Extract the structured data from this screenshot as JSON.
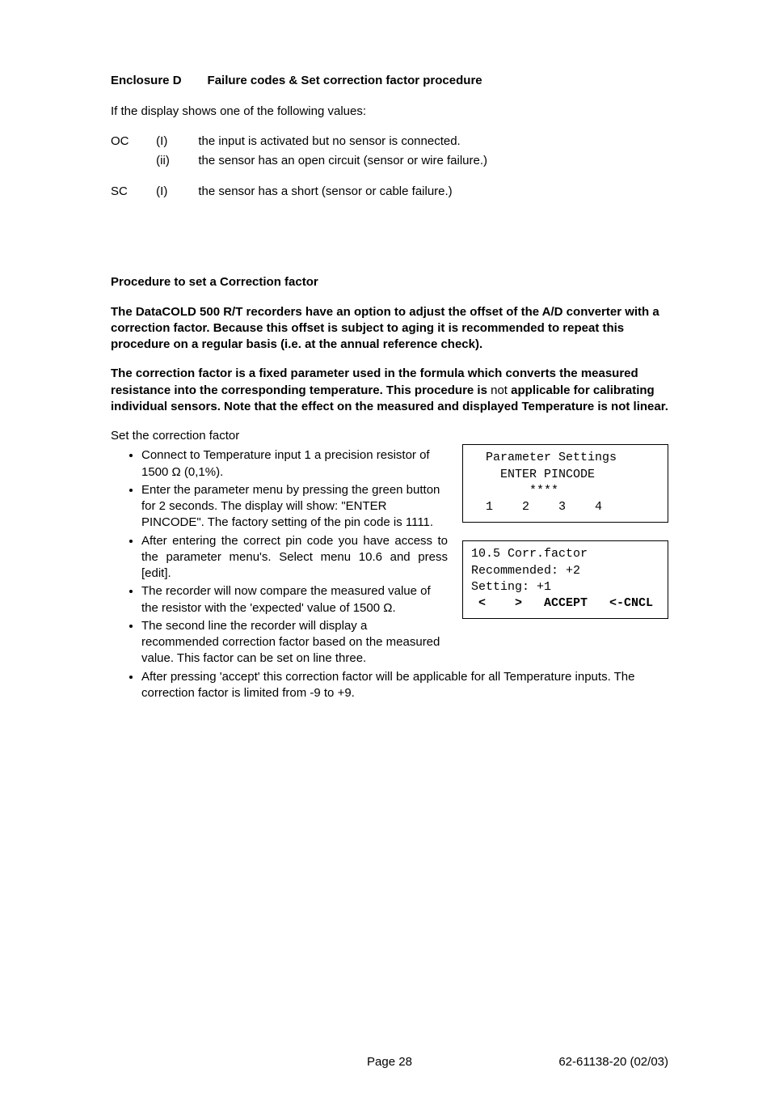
{
  "heading": {
    "label": "Enclosure D",
    "title": "Failure codes  &  Set correction factor procedure"
  },
  "intro": "If the display shows one of the following values:",
  "codes": {
    "oc": {
      "label": "OC",
      "rows": [
        {
          "roman": "(I)",
          "text": "the input is activated but no sensor is connected."
        },
        {
          "roman": "(ii)",
          "text": "the sensor has an open circuit (sensor or wire failure.)"
        }
      ]
    },
    "sc": {
      "label": "SC",
      "rows": [
        {
          "roman": "(I)",
          "text": "the sensor has a short (sensor or cable failure.)"
        }
      ]
    }
  },
  "procTitle": "Procedure to set a Correction factor",
  "para1": "The DataCOLD 500 R/T recorders have an option to adjust the offset of the A/D converter with a correction factor. Because this offset is subject to aging it is recommended to repeat this procedure on a regular basis (i.e. at the annual reference check).",
  "para2a": "The correction factor is a fixed parameter used in the formula which converts the measured resistance into the corresponding temperature. This procedure is ",
  "para2b": "not",
  "para2c": " applicable for calibrating individual sensors. Note that the effect on the measured and displayed Temperature is not linear.",
  "setTitle": "Set the correction factor",
  "bullets": [
    "Connect to Temperature input 1 a precision resistor of 1500 Ω (0,1%).",
    "Enter the parameter menu by pressing the green button for 2 seconds. The display will show: \"ENTER PINCODE\". The factory setting of the pin code is 1111.",
    "After entering the correct pin code you have access to the parameter menu's. Select menu 10.6 and press [edit].",
    "The recorder will now compare the measured value of the resistor with the 'expected' value of 1500 Ω.",
    "The second line the recorder will display a recommended correction factor based on the measured value. This factor can be set on line three.",
    "After pressing 'accept' this correction factor will be applicable for all Temperature inputs. The correction factor is limited from -9 to +9."
  ],
  "panel1": {
    "l1": "  Parameter Settings",
    "l2": "    ENTER PINCODE",
    "l3": "        ****",
    "l4": "  1    2    3    4"
  },
  "panel2": {
    "l1": "10.5 Corr.factor",
    "l2": "Recommended: +2",
    "l3": "Setting: +1",
    "l4": " <    >   ACCEPT   <-CNCL"
  },
  "footer": {
    "center": "Page  28",
    "right": "62-61138-20   (02/03)"
  }
}
